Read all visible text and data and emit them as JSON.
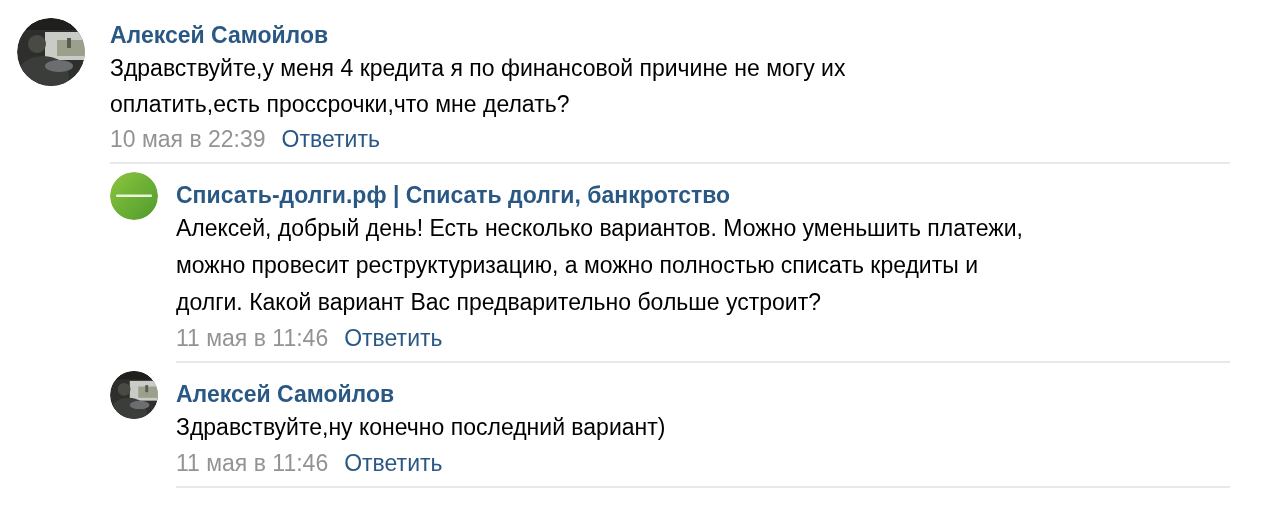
{
  "comments": [
    {
      "author": "Алексей Самойлов",
      "text": "Здравствуйте,у меня 4 кредита я по финансовой причине не могу их оплатить,есть проссрочки,что мне делать?",
      "date": "10 мая в 22:39",
      "reply_link": "Ответить",
      "children": [
        {
          "author": "Списать-долги.рф | Списать долги, банкротство",
          "avatar": {
            "kind": "logo"
          },
          "text": "Алексей, добрый день! Есть несколько вариантов. Можно уменьшить платежи, можно провесит реструктуризацию, а можно полностью списать кредиты и долги. Какой вариант Вас предварительно больше устроит?",
          "date": "11 мая в 11:46",
          "reply_link": "Ответить"
        },
        {
          "author": "Алексей Самойлов",
          "text": "Здравствуйте,ну конечно последний вариант)",
          "date": "11 мая в 11:46",
          "reply_link": "Ответить"
        }
      ]
    }
  ]
}
